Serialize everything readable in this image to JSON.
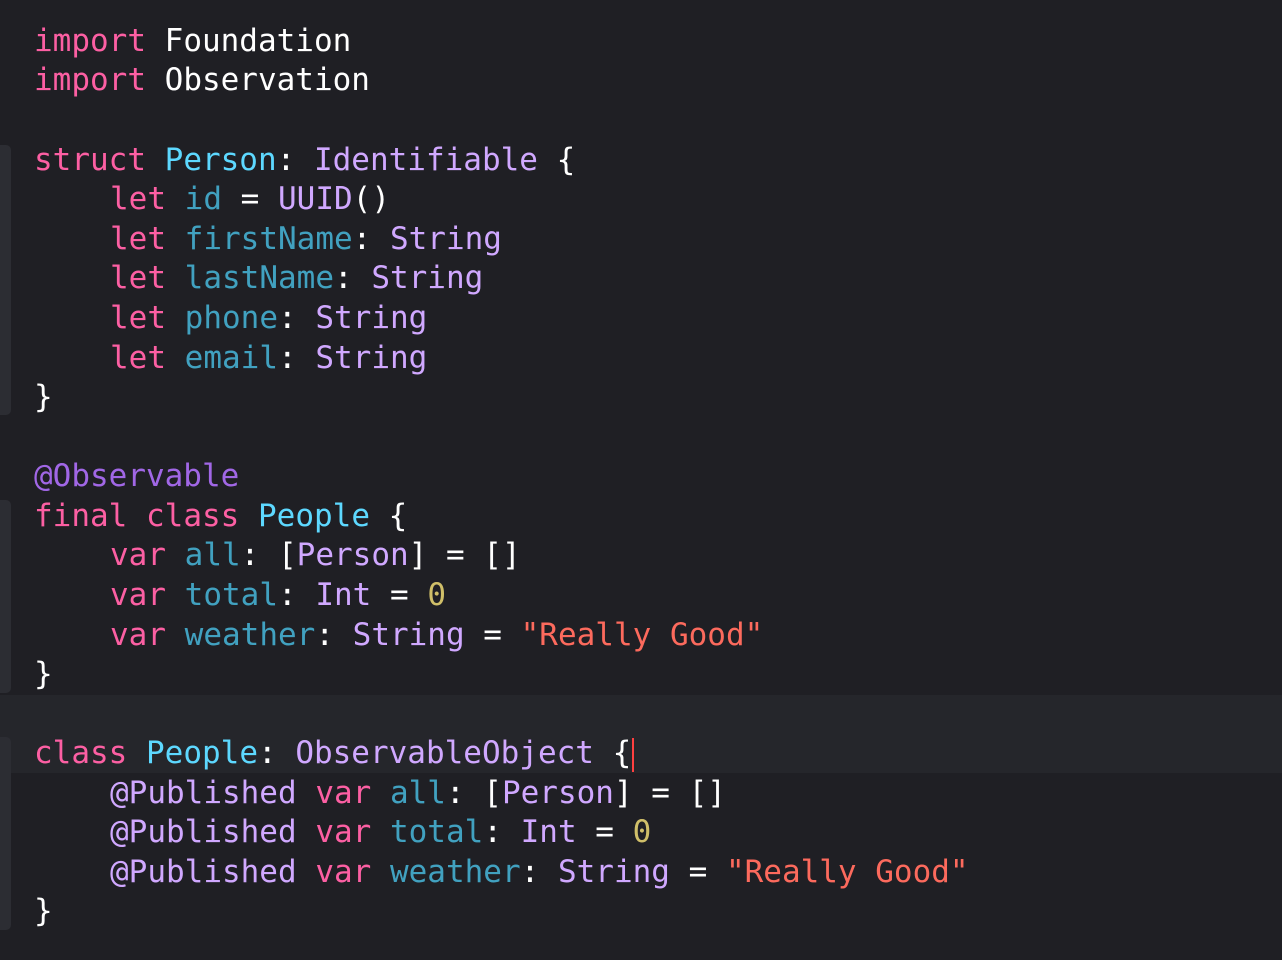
{
  "editor": {
    "colors": {
      "background": "#1f1f24",
      "keyword": "#fc5fa3",
      "type_declaration": "#5dd8ff",
      "type": "#d0a8ff",
      "property": "#41a1c0",
      "attribute": "#a167e6",
      "string": "#fc6a5d",
      "number": "#d0bf69",
      "cursor": "#ff4040"
    },
    "lines": [
      {
        "tokens": [
          {
            "t": "import",
            "c": "kw"
          },
          {
            "t": " ",
            "c": "plain"
          },
          {
            "t": "Foundation",
            "c": "plain"
          }
        ]
      },
      {
        "tokens": [
          {
            "t": "import",
            "c": "kw"
          },
          {
            "t": " ",
            "c": "plain"
          },
          {
            "t": "Observation",
            "c": "plain"
          }
        ]
      },
      {
        "tokens": [
          {
            "t": "struct",
            "c": "kw"
          },
          {
            "t": " ",
            "c": "plain"
          },
          {
            "t": "Person",
            "c": "typedecl"
          },
          {
            "t": ": ",
            "c": "plain"
          },
          {
            "t": "Identifiable",
            "c": "type"
          },
          {
            "t": " {",
            "c": "plain"
          }
        ]
      },
      {
        "tokens": [
          {
            "t": "let",
            "c": "kw"
          },
          {
            "t": " ",
            "c": "plain"
          },
          {
            "t": "id",
            "c": "prop"
          },
          {
            "t": " = ",
            "c": "plain"
          },
          {
            "t": "UUID",
            "c": "type"
          },
          {
            "t": "()",
            "c": "plain"
          }
        ]
      },
      {
        "tokens": [
          {
            "t": "let",
            "c": "kw"
          },
          {
            "t": " ",
            "c": "plain"
          },
          {
            "t": "firstName",
            "c": "prop"
          },
          {
            "t": ": ",
            "c": "plain"
          },
          {
            "t": "String",
            "c": "type"
          }
        ]
      },
      {
        "tokens": [
          {
            "t": "let",
            "c": "kw"
          },
          {
            "t": " ",
            "c": "plain"
          },
          {
            "t": "lastName",
            "c": "prop"
          },
          {
            "t": ": ",
            "c": "plain"
          },
          {
            "t": "String",
            "c": "type"
          }
        ]
      },
      {
        "tokens": [
          {
            "t": "let",
            "c": "kw"
          },
          {
            "t": " ",
            "c": "plain"
          },
          {
            "t": "phone",
            "c": "prop"
          },
          {
            "t": ": ",
            "c": "plain"
          },
          {
            "t": "String",
            "c": "type"
          }
        ]
      },
      {
        "tokens": [
          {
            "t": "let",
            "c": "kw"
          },
          {
            "t": " ",
            "c": "plain"
          },
          {
            "t": "email",
            "c": "prop"
          },
          {
            "t": ": ",
            "c": "plain"
          },
          {
            "t": "String",
            "c": "type"
          }
        ]
      },
      {
        "tokens": [
          {
            "t": "}",
            "c": "plain"
          }
        ]
      },
      {
        "tokens": [
          {
            "t": "@Observable",
            "c": "attr"
          }
        ]
      },
      {
        "tokens": [
          {
            "t": "final",
            "c": "kw"
          },
          {
            "t": " ",
            "c": "plain"
          },
          {
            "t": "class",
            "c": "kw"
          },
          {
            "t": " ",
            "c": "plain"
          },
          {
            "t": "People",
            "c": "typedecl"
          },
          {
            "t": " {",
            "c": "plain"
          }
        ]
      },
      {
        "tokens": [
          {
            "t": "var",
            "c": "kw"
          },
          {
            "t": " ",
            "c": "plain"
          },
          {
            "t": "all",
            "c": "prop"
          },
          {
            "t": ": [",
            "c": "plain"
          },
          {
            "t": "Person",
            "c": "type"
          },
          {
            "t": "] = []",
            "c": "plain"
          }
        ]
      },
      {
        "tokens": [
          {
            "t": "var",
            "c": "kw"
          },
          {
            "t": " ",
            "c": "plain"
          },
          {
            "t": "total",
            "c": "prop"
          },
          {
            "t": ": ",
            "c": "plain"
          },
          {
            "t": "Int",
            "c": "type"
          },
          {
            "t": " = ",
            "c": "plain"
          },
          {
            "t": "0",
            "c": "num"
          }
        ]
      },
      {
        "tokens": [
          {
            "t": "var",
            "c": "kw"
          },
          {
            "t": " ",
            "c": "plain"
          },
          {
            "t": "weather",
            "c": "prop"
          },
          {
            "t": ": ",
            "c": "plain"
          },
          {
            "t": "String",
            "c": "type"
          },
          {
            "t": " = ",
            "c": "plain"
          },
          {
            "t": "\"Really Good\"",
            "c": "str"
          }
        ]
      },
      {
        "tokens": [
          {
            "t": "}",
            "c": "plain"
          }
        ]
      },
      {
        "tokens": [
          {
            "t": "class",
            "c": "kw"
          },
          {
            "t": " ",
            "c": "plain"
          },
          {
            "t": "People",
            "c": "typedecl"
          },
          {
            "t": ": ",
            "c": "plain"
          },
          {
            "t": "ObservableObject",
            "c": "type"
          },
          {
            "t": " {",
            "c": "plain"
          }
        ]
      },
      {
        "tokens": [
          {
            "t": "@Published",
            "c": "type"
          },
          {
            "t": " ",
            "c": "plain"
          },
          {
            "t": "var",
            "c": "kw"
          },
          {
            "t": " ",
            "c": "plain"
          },
          {
            "t": "all",
            "c": "prop"
          },
          {
            "t": ": [",
            "c": "plain"
          },
          {
            "t": "Person",
            "c": "type"
          },
          {
            "t": "] = []",
            "c": "plain"
          }
        ]
      },
      {
        "tokens": [
          {
            "t": "@Published",
            "c": "type"
          },
          {
            "t": " ",
            "c": "plain"
          },
          {
            "t": "var",
            "c": "kw"
          },
          {
            "t": " ",
            "c": "plain"
          },
          {
            "t": "total",
            "c": "prop"
          },
          {
            "t": ": ",
            "c": "plain"
          },
          {
            "t": "Int",
            "c": "type"
          },
          {
            "t": " = ",
            "c": "plain"
          },
          {
            "t": "0",
            "c": "num"
          }
        ]
      },
      {
        "tokens": [
          {
            "t": "@Published",
            "c": "type"
          },
          {
            "t": " ",
            "c": "plain"
          },
          {
            "t": "var",
            "c": "kw"
          },
          {
            "t": " ",
            "c": "plain"
          },
          {
            "t": "weather",
            "c": "prop"
          },
          {
            "t": ": ",
            "c": "plain"
          },
          {
            "t": "String",
            "c": "type"
          },
          {
            "t": " = ",
            "c": "plain"
          },
          {
            "t": "\"Really Good\"",
            "c": "str"
          }
        ]
      },
      {
        "tokens": [
          {
            "t": "}",
            "c": "plain"
          }
        ]
      }
    ]
  }
}
